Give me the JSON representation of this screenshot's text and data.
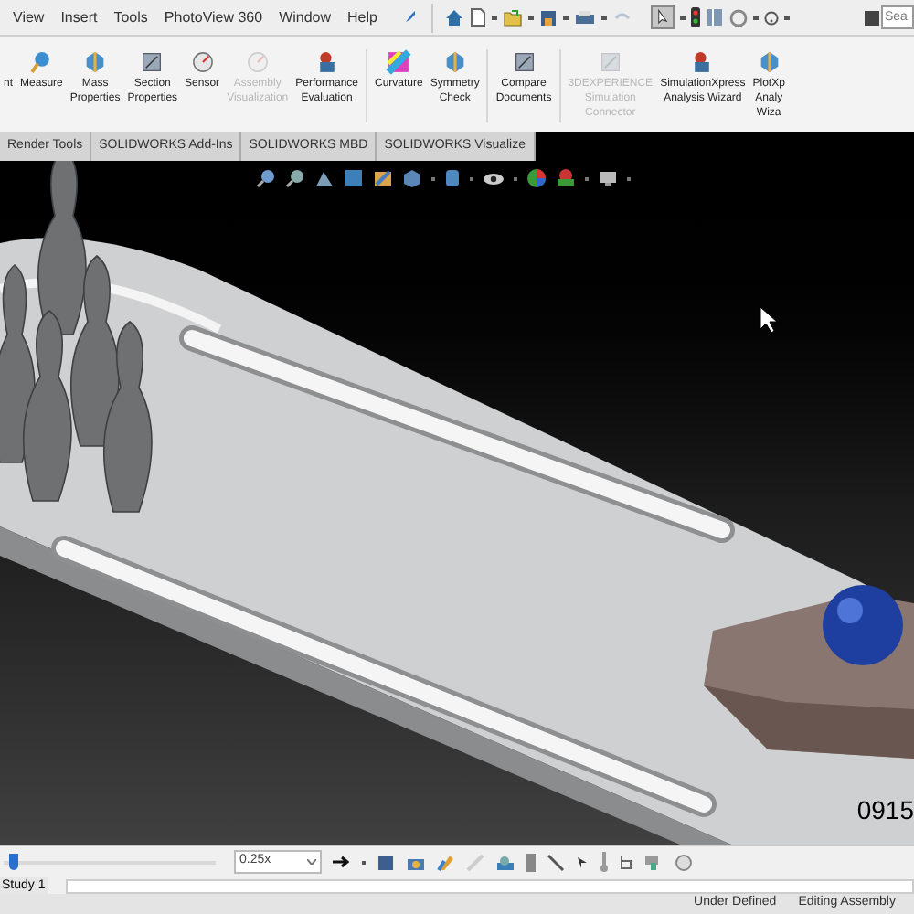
{
  "menu": [
    "View",
    "Insert",
    "Tools",
    "PhotoView 360",
    "Window",
    "Help"
  ],
  "search": {
    "placeholder": "Sea"
  },
  "ribbon": [
    {
      "label": "nt",
      "disabled": false
    },
    {
      "label": "Measure",
      "disabled": false
    },
    {
      "label": "Mass Properties",
      "disabled": false
    },
    {
      "label": "Section Properties",
      "disabled": false
    },
    {
      "label": "Sensor",
      "disabled": false
    },
    {
      "label": "Assembly Visualization",
      "disabled": true
    },
    {
      "label": "Performance Evaluation",
      "disabled": false
    },
    {
      "label": "Curvature",
      "disabled": false
    },
    {
      "label": "Symmetry Check",
      "disabled": false
    },
    {
      "label": "Compare Documents",
      "disabled": false
    },
    {
      "label": "3DEXPERIENCE Simulation Connector",
      "disabled": true
    },
    {
      "label": "SimulationXpress Analysis Wizard",
      "disabled": false
    },
    {
      "label": "PlotXp Analy Wiza",
      "disabled": false
    }
  ],
  "tabs": [
    "Render Tools",
    "SOLIDWORKS Add-Ins",
    "SOLIDWORKS MBD",
    "SOLIDWORKS Visualize"
  ],
  "model_label": "0915",
  "timeline": {
    "level": 0.03,
    "speed": "0.25x"
  },
  "study_tab": "Study 1",
  "status": [
    "Under Defined",
    "Editing Assembly"
  ]
}
